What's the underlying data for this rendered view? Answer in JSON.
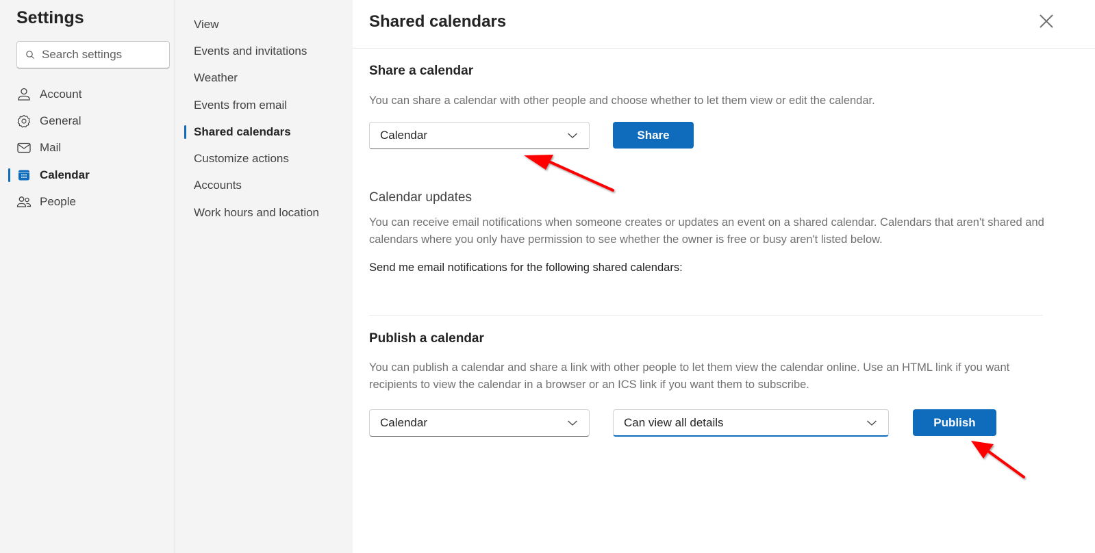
{
  "settings": {
    "title": "Settings",
    "search": {
      "placeholder": "Search settings",
      "value": ""
    },
    "nav": [
      {
        "label": "Account",
        "icon": "person-icon",
        "active": false
      },
      {
        "label": "General",
        "icon": "gear-icon",
        "active": false
      },
      {
        "label": "Mail",
        "icon": "mail-icon",
        "active": false
      },
      {
        "label": "Calendar",
        "icon": "calendar-icon",
        "active": true
      },
      {
        "label": "People",
        "icon": "people-icon",
        "active": false
      }
    ]
  },
  "subnav": [
    {
      "label": "View",
      "active": false
    },
    {
      "label": "Events and invitations",
      "active": false
    },
    {
      "label": "Weather",
      "active": false
    },
    {
      "label": "Events from email",
      "active": false
    },
    {
      "label": "Shared calendars",
      "active": true
    },
    {
      "label": "Customize actions",
      "active": false
    },
    {
      "label": "Accounts",
      "active": false
    },
    {
      "label": "Work hours and location",
      "active": false
    }
  ],
  "main": {
    "title": "Shared calendars",
    "close_icon": "close-icon",
    "share": {
      "title": "Share a calendar",
      "description": "You can share a calendar with other people and choose whether to let them view or edit the calendar.",
      "calendar_select": "Calendar",
      "button": "Share"
    },
    "updates": {
      "title": "Calendar updates",
      "description": "You can receive email notifications when someone creates or updates an event on a shared calendar. Calendars that aren't shared and calendars where you only have permission to see whether the owner is free or busy aren't listed below.",
      "prompt": "Send me email notifications for the following shared calendars:"
    },
    "publish": {
      "title": "Publish a calendar",
      "description": "You can publish a calendar and share a link with other people to let them view the calendar online. Use an HTML link if you want recipients to view the calendar in a browser or an ICS link if you want them to subscribe.",
      "calendar_select": "Calendar",
      "permission_select": "Can view all details",
      "button": "Publish"
    }
  },
  "colors": {
    "accent": "#0f6cbd",
    "annotation_arrow": "#ff0000",
    "sidebar_bg": "#f4f4f4"
  }
}
